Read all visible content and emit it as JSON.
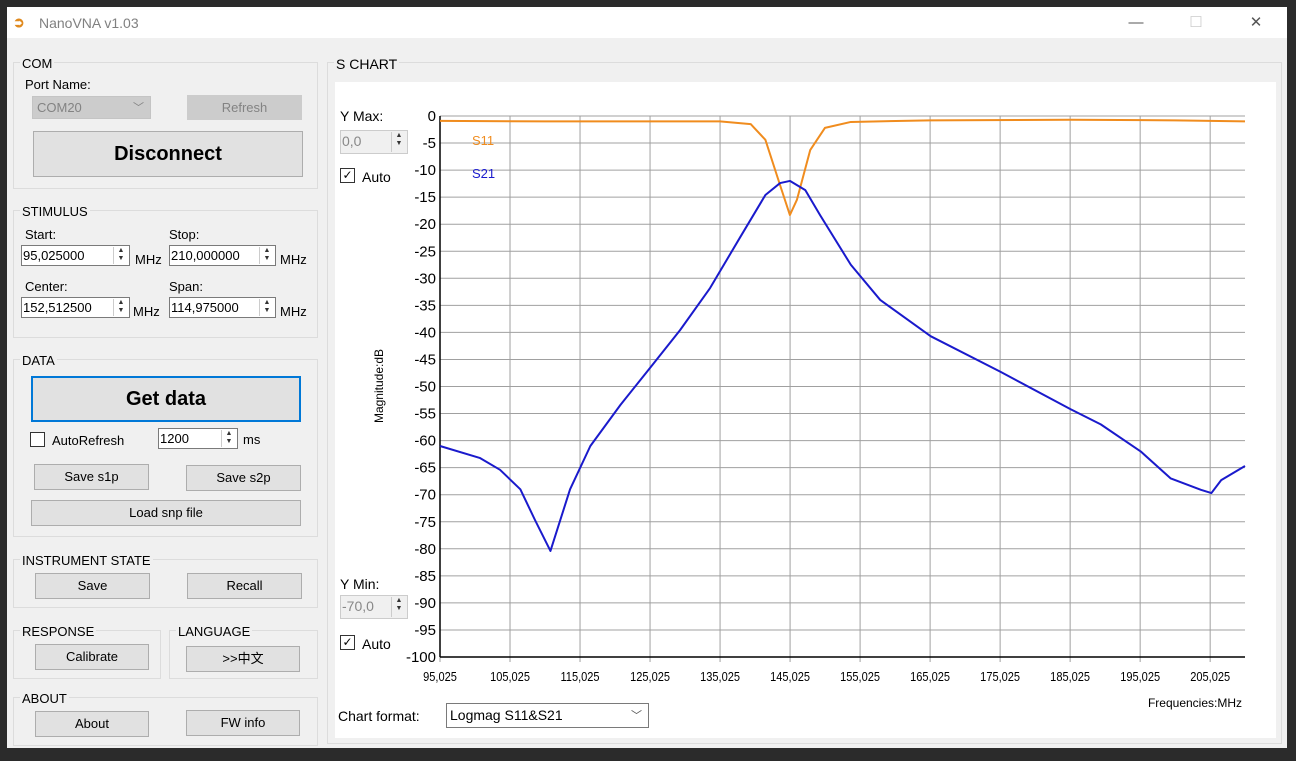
{
  "window": {
    "title": "NanoVNA v1.03",
    "minimize": "—",
    "maximize": "☐",
    "close": "✕"
  },
  "com": {
    "label": "COM",
    "port_label": "Port Name:",
    "port_value": "COM20",
    "refresh": "Refresh",
    "disconnect": "Disconnect"
  },
  "stimulus": {
    "label": "STIMULUS",
    "start_label": "Start:",
    "start": "95,025000",
    "stop_label": "Stop:",
    "stop": "210,000000",
    "center_label": "Center:",
    "center": "152,512500",
    "span_label": "Span:",
    "span": "114,975000",
    "unit": "MHz"
  },
  "data": {
    "label": "DATA",
    "get_data": "Get data",
    "autorefresh": "AutoRefresh",
    "autorefresh_checked": false,
    "interval": "1200",
    "interval_unit": "ms",
    "save_s1p": "Save s1p",
    "save_s2p": "Save s2p",
    "load_snp": "Load snp file"
  },
  "instrument": {
    "label": "INSTRUMENT STATE",
    "save": "Save",
    "recall": "Recall"
  },
  "response": {
    "label": "RESPONSE",
    "calibrate": "Calibrate"
  },
  "language": {
    "label": "LANGUAGE",
    "switch": ">>中文"
  },
  "about": {
    "label": "ABOUT",
    "about": "About",
    "fw": "FW info"
  },
  "chart_panel": {
    "label": "S CHART",
    "ymax_label": "Y Max:",
    "ymax": "0,0",
    "ymax_auto": "Auto",
    "ymin_label": "Y Min:",
    "ymin": "-70,0",
    "ymin_auto": "Auto",
    "format_label": "Chart format:",
    "format": "Logmag S11&S21"
  },
  "chart_data": {
    "type": "line",
    "ylabel": "Magnitude:dB",
    "xlabel": "Frequencies:MHz",
    "xlim": [
      95.025,
      210
    ],
    "ylim": [
      -100,
      0
    ],
    "grid": true,
    "legend": "top-left",
    "xticks": [
      "95,025",
      "105,025",
      "115,025",
      "125,025",
      "135,025",
      "145,025",
      "155,025",
      "165,025",
      "175,025",
      "185,025",
      "195,025",
      "205,025"
    ],
    "yticks": [
      "0",
      "-5",
      "-10",
      "-15",
      "-20",
      "-25",
      "-30",
      "-35",
      "-40",
      "-45",
      "-50",
      "-55",
      "-60",
      "-65",
      "-70",
      "-75",
      "-80",
      "-85",
      "-90",
      "-95",
      "-100"
    ],
    "series": [
      {
        "name": "S11",
        "color": "#f08c1e",
        "x": [
          95.025,
          110,
          125,
          135,
          139.4,
          141.5,
          143.6,
          145,
          146,
          147.9,
          150,
          153.7,
          165,
          185,
          200,
          210
        ],
        "y": [
          -0.9,
          -1,
          -1,
          -1,
          -1.5,
          -4.4,
          -12.8,
          -18.3,
          -15.5,
          -6.3,
          -2.2,
          -1.1,
          -0.8,
          -0.7,
          -0.8,
          -1
        ]
      },
      {
        "name": "S21",
        "color": "#1a1acc",
        "x": [
          95.025,
          100.7,
          103.6,
          106.5,
          108.6,
          110.8,
          113.6,
          116.5,
          120.8,
          125,
          129.3,
          133.6,
          137.9,
          141.5,
          143.6,
          145,
          147.2,
          149.3,
          153.7,
          157.9,
          165.1,
          175.1,
          185.1,
          189.4,
          195.1,
          199.4,
          203.7,
          205.2,
          206.6,
          210
        ],
        "y": [
          -61,
          -63.2,
          -65.4,
          -69,
          -74.7,
          -80.4,
          -69,
          -61,
          -53.4,
          -46.6,
          -39.6,
          -31.8,
          -22.4,
          -14.6,
          -12.4,
          -12,
          -13.7,
          -18.3,
          -27.5,
          -34,
          -40.7,
          -47.3,
          -54.2,
          -57,
          -62,
          -67,
          -69.1,
          -69.7,
          -67.3,
          -64.7
        ]
      }
    ]
  }
}
